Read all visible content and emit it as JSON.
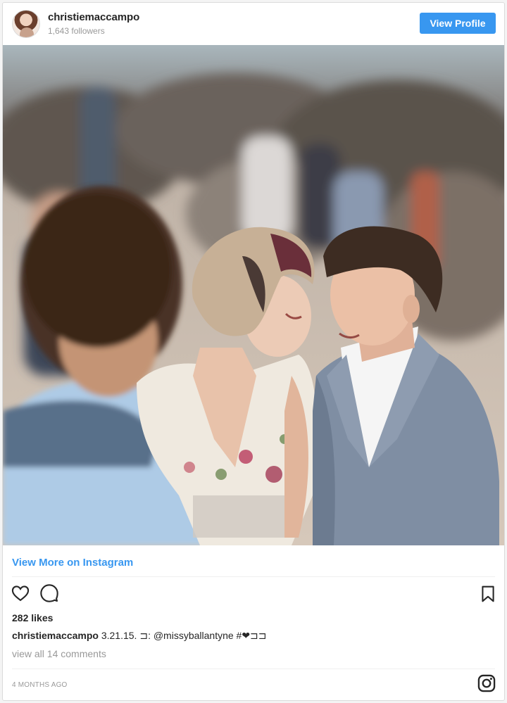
{
  "header": {
    "username": "christiemaccampo",
    "followers": "1,643 followers",
    "view_profile_label": "View Profile"
  },
  "photo": {
    "description_icon": "wedding-photo"
  },
  "link": {
    "view_more_label": "View More on Instagram"
  },
  "actions": {
    "like_icon": "heart-icon",
    "comment_icon": "comment-icon",
    "save_icon": "bookmark-icon"
  },
  "post": {
    "likes": "282 likes",
    "caption_user": "christiemaccampo",
    "caption_text": "3.21.15. ⊐: @missyballantyne #❤⊐⊐",
    "comments_link": "view all 14 comments",
    "timestamp": "4 MONTHS AGO"
  },
  "footer": {
    "instagram_icon": "instagram-logo-icon"
  },
  "colors": {
    "accent": "#3897f0",
    "text": "#262626",
    "muted": "#999999",
    "border": "#dbdbdb"
  }
}
